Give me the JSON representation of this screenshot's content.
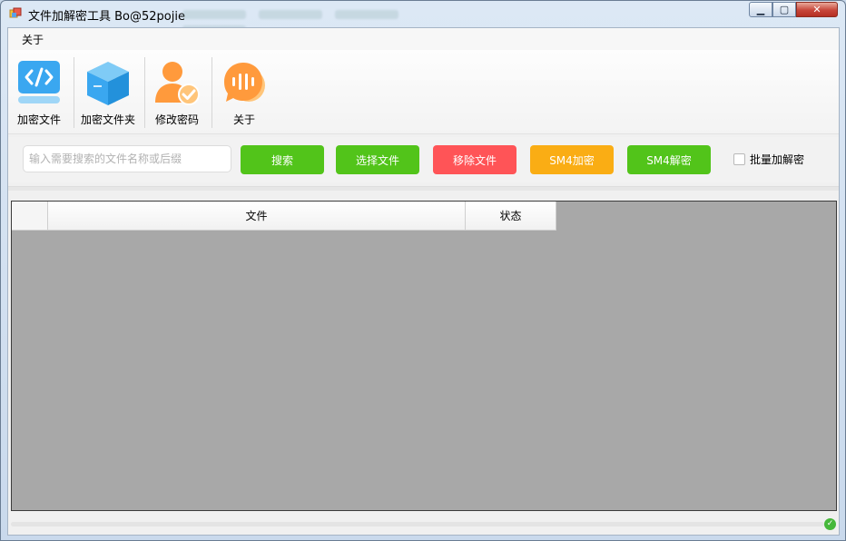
{
  "window": {
    "title": "文件加解密工具 Bo@52pojie",
    "buttons": {
      "minimize": "▁",
      "maximize": "▢",
      "close": "✕"
    }
  },
  "menu": {
    "items": [
      {
        "label": "关于"
      }
    ]
  },
  "toolbar": {
    "items": [
      {
        "label": "加密文件",
        "icon": "code-file-icon"
      },
      {
        "label": "加密文件夹",
        "icon": "box-icon"
      },
      {
        "label": "修改密码",
        "icon": "user-check-icon"
      },
      {
        "label": "关于",
        "icon": "chat-bubble-icon"
      }
    ]
  },
  "search": {
    "placeholder": "输入需要搜索的文件名称或后缀",
    "value": ""
  },
  "actions": {
    "search": "搜索",
    "select_file": "选择文件",
    "remove_file": "移除文件",
    "sm4_encrypt": "SM4加密",
    "sm4_decrypt": "SM4解密",
    "batch_label": "批量加解密",
    "batch_checked": false
  },
  "colors": {
    "green": "#52c41a",
    "red": "#ff5457",
    "orange": "#faad14",
    "icon_blue": "#3aa7f0",
    "icon_orange": "#ff9a3c",
    "grid_bg": "#a8a8a8"
  },
  "table": {
    "columns": [
      {
        "label": "文件"
      },
      {
        "label": "状态"
      }
    ],
    "rows": []
  },
  "status": {
    "progress": 0,
    "icon": "check-circle-icon"
  }
}
